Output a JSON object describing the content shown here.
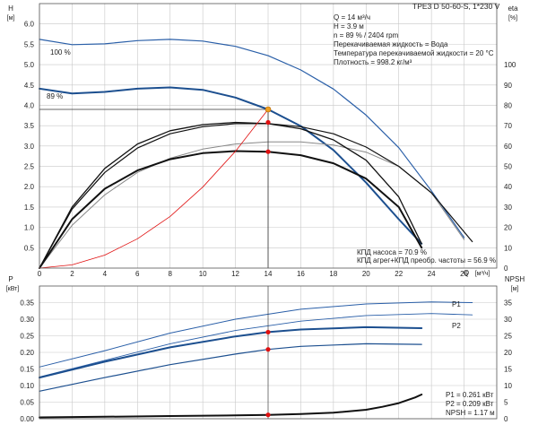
{
  "title": "TPE3 D 50-60-S, 1*230 V",
  "info_lines": [
    "Q = 14 м³/ч",
    "H = 3.9 м",
    "n = 89 % / 2404 rpm",
    "Перекачиваемая жидкость = Вода",
    "Температура перекачиваемой жидкости = 20 °C",
    "Плотность = 998.2 кг/м³"
  ],
  "efficiency_notes": [
    "КПД насоса = 70.9 %",
    "КПД агрег+КПД преобр. частоты = 56.9 %"
  ],
  "power_notes": [
    "P1 = 0.261 кВт",
    "P2 = 0.209 кВт",
    "NPSH = 1.17 м"
  ],
  "colors": {
    "blue": "#2a5fa8",
    "dark_blue": "#1c4f8f",
    "red": "#e01010",
    "orange": "#f0a020",
    "grey": "#888888",
    "black": "#111111"
  },
  "chart_data": [
    {
      "type": "line",
      "ylabel": "H",
      "yunit": "[м]",
      "y2label": "eta",
      "y2unit": "[%]",
      "xlabel": "Q",
      "xunit": "[м³/ч]",
      "xlim": [
        0,
        28
      ],
      "ylim": [
        0,
        6.5
      ],
      "y2lim": [
        0,
        130
      ],
      "xticks": [
        0,
        2,
        4,
        6,
        8,
        10,
        12,
        14,
        16,
        18,
        20,
        22,
        24,
        26
      ],
      "yticks": [
        0.5,
        1.0,
        1.5,
        2.0,
        2.5,
        3.0,
        3.5,
        4.0,
        4.5,
        5.0,
        5.5,
        6.0
      ],
      "y2ticks": [
        0,
        10,
        20,
        30,
        40,
        50,
        60,
        70,
        80,
        90,
        100
      ],
      "annotations": [
        "100 %",
        "89 %"
      ],
      "operating_point": {
        "q": 14,
        "h": 3.9,
        "eta_pump": 71.6,
        "eta_total": 57.2
      },
      "series": [
        {
          "role": "head_100",
          "axis": "left",
          "x": [
            0,
            2,
            4,
            6,
            8,
            10,
            12,
            14,
            16,
            18,
            20,
            22,
            24,
            26
          ],
          "y": [
            5.62,
            5.49,
            5.51,
            5.59,
            5.62,
            5.58,
            5.45,
            5.22,
            4.87,
            4.4,
            3.76,
            2.96,
            1.9,
            0.75
          ]
        },
        {
          "role": "head_89",
          "axis": "left",
          "x": [
            0,
            2,
            4,
            6,
            8,
            10,
            12,
            14,
            16,
            18,
            20,
            22,
            23.4
          ],
          "y": [
            4.41,
            4.29,
            4.33,
            4.41,
            4.44,
            4.38,
            4.19,
            3.9,
            3.49,
            2.9,
            2.1,
            1.2,
            0.6
          ]
        },
        {
          "role": "eta_total_100",
          "axis": "right",
          "x": [
            0,
            2,
            4,
            6,
            8,
            10,
            12,
            14,
            16,
            18,
            20,
            22,
            24,
            26
          ],
          "y": [
            0,
            21,
            36,
            47,
            54,
            58.5,
            61,
            62,
            62,
            60.5,
            57,
            50,
            37,
            14
          ]
        },
        {
          "role": "eta_pump_100",
          "axis": "right",
          "x": [
            0,
            2,
            4,
            6,
            8,
            10,
            12,
            14,
            16,
            18,
            20,
            22,
            24,
            26.5
          ],
          "y": [
            0,
            29,
            47,
            59,
            66,
            69.5,
            71,
            71,
            69.5,
            66,
            59.5,
            50,
            37,
            13
          ]
        },
        {
          "role": "eta_pump_89",
          "axis": "right",
          "x": [
            0,
            2,
            4,
            6,
            8,
            10,
            12,
            14,
            16,
            18,
            20,
            22,
            23.4
          ],
          "y": [
            0,
            30,
            49,
            61,
            67.5,
            70.5,
            71.6,
            71,
            68.5,
            63,
            53,
            35,
            12
          ]
        },
        {
          "role": "eta_total_89",
          "axis": "right",
          "x": [
            0,
            2,
            4,
            6,
            8,
            10,
            12,
            14,
            16,
            18,
            20,
            22,
            23.4
          ],
          "y": [
            0,
            24,
            39,
            48,
            53.5,
            56.5,
            57.5,
            57.2,
            55.5,
            51.5,
            44,
            30,
            10
          ]
        },
        {
          "role": "system_curve",
          "axis": "left",
          "x": [
            0,
            2,
            4,
            6,
            8,
            10,
            12,
            14
          ],
          "y": [
            0,
            0.08,
            0.32,
            0.72,
            1.27,
            1.99,
            2.87,
            3.9
          ]
        }
      ]
    },
    {
      "type": "line",
      "ylabel": "P",
      "yunit": "[кВт]",
      "y2label": "NPSH",
      "y2unit": "[м]",
      "xlim": [
        0,
        28
      ],
      "ylim": [
        0,
        0.4
      ],
      "y2lim": [
        0,
        40
      ],
      "yticks": [
        0.0,
        0.05,
        0.1,
        0.15,
        0.2,
        0.25,
        0.3,
        0.35
      ],
      "y2ticks": [
        0,
        5,
        10,
        15,
        20,
        25,
        30,
        35
      ],
      "series": [
        {
          "name": "P1",
          "axis": "left",
          "x": [
            0,
            4,
            8,
            12,
            16,
            20,
            24,
            26.5
          ],
          "y": [
            0.156,
            0.205,
            0.258,
            0.3,
            0.33,
            0.346,
            0.352,
            0.35
          ]
        },
        {
          "name": "P2",
          "axis": "left",
          "x": [
            0,
            4,
            8,
            12,
            16,
            20,
            24,
            26.5
          ],
          "y": [
            0.126,
            0.176,
            0.226,
            0.266,
            0.294,
            0.311,
            0.317,
            0.313
          ]
        },
        {
          "role": "p1_89",
          "axis": "left",
          "x": [
            0,
            4,
            8,
            12,
            14,
            16,
            20,
            23.4
          ],
          "y": [
            0.124,
            0.172,
            0.215,
            0.248,
            0.261,
            0.269,
            0.276,
            0.273
          ]
        },
        {
          "role": "p2_89",
          "axis": "left",
          "x": [
            0,
            4,
            8,
            12,
            14,
            16,
            20,
            23.4
          ],
          "y": [
            0.083,
            0.124,
            0.163,
            0.195,
            0.209,
            0.218,
            0.226,
            0.224
          ]
        },
        {
          "role": "npsh",
          "axis": "right",
          "x": [
            0,
            4,
            8,
            12,
            14,
            16,
            18,
            20,
            21,
            22,
            23,
            23.4
          ],
          "y": [
            0.4,
            0.6,
            0.8,
            1.0,
            1.17,
            1.4,
            1.8,
            2.7,
            3.6,
            4.7,
            6.4,
            7.3
          ]
        }
      ],
      "points": [
        {
          "q": 14,
          "value": 0.261,
          "axis": "left"
        },
        {
          "q": 14,
          "value": 0.209,
          "axis": "left"
        },
        {
          "q": 14,
          "value": 1.17,
          "axis": "right"
        }
      ]
    }
  ]
}
